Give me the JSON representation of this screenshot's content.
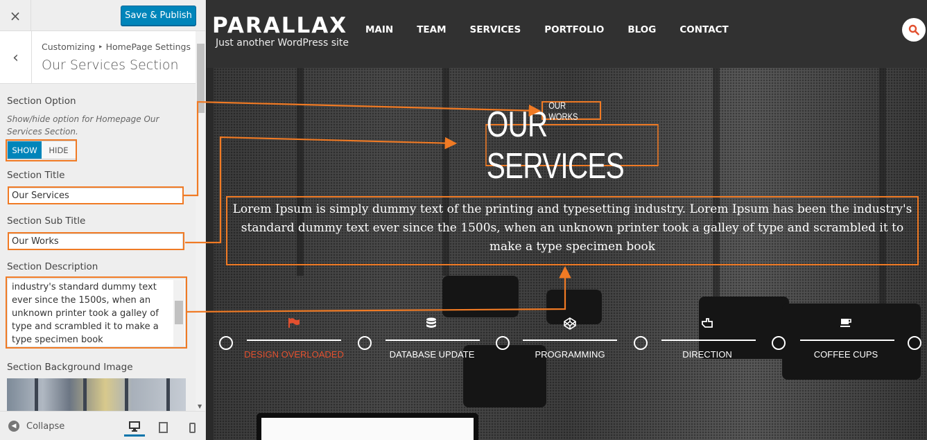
{
  "customizer": {
    "close_icon": "×",
    "publish_label": "Save & Publish",
    "breadcrumb": "Customizing ‣ HomePage Settings",
    "section_title": "Our Services Section",
    "back_icon": "‹",
    "controls": {
      "section_option_label": "Section Option",
      "section_option_desc": "Show/hide option for Homepage Our Services Section.",
      "show_label": "SHOW",
      "hide_label": "HIDE",
      "title_label": "Section Title",
      "title_value": "Our Services",
      "subtitle_label": "Section Sub Title",
      "subtitle_value": "Our Works",
      "description_label": "Section Description",
      "description_value": "industry's standard dummy text ever since the 1500s, when an unknown printer took a galley of type and scrambled it to make a type specimen book",
      "bg_image_label": "Section Background Image"
    },
    "footer": {
      "collapse_label": "Collapse"
    }
  },
  "site": {
    "logo": "PARALLAX",
    "tagline": "Just another WordPress site",
    "menu": [
      "MAIN",
      "TEAM",
      "SERVICES",
      "PORTFOLIO",
      "BLOG",
      "CONTACT"
    ]
  },
  "services_section": {
    "subtitle": "OUR WORKS",
    "title": "OUR SERVICES",
    "description": "Lorem Ipsum is simply dummy text of the printing and typesetting industry. Lorem Ipsum has been the industry's standard dummy text ever since the 1500s, when an unknown printer took a galley of type and scrambled it to make a type specimen book",
    "items": [
      {
        "label": "DESIGN OVERLOADED",
        "icon": "flag-icon",
        "active": true
      },
      {
        "label": "DATABASE UPDATE",
        "icon": "database-icon",
        "active": false
      },
      {
        "label": "PROGRAMMING",
        "icon": "codepen-icon",
        "active": false
      },
      {
        "label": "DIRECTION",
        "icon": "hand-pointer-icon",
        "active": false
      },
      {
        "label": "COFFEE CUPS",
        "icon": "coffee-icon",
        "active": false
      }
    ]
  },
  "colors": {
    "accent_blue": "#0085ba",
    "annotation_orange": "#f07a24",
    "active_item": "#e2502f"
  }
}
